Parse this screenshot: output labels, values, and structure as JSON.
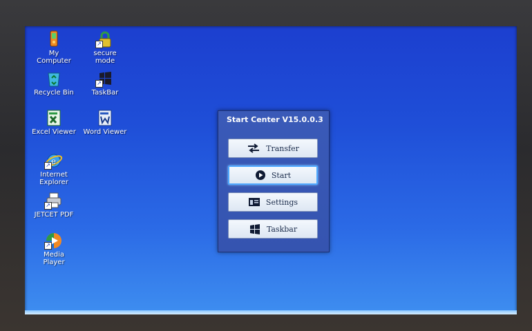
{
  "desktop": {
    "icons": [
      {
        "id": "my-computer",
        "label": "My Computer",
        "icon": "my-computer-icon"
      },
      {
        "id": "secure-mode",
        "label": "secure mode",
        "icon": "lock-icon"
      },
      {
        "id": "recycle-bin",
        "label": "Recycle Bin",
        "icon": "recycle-bin-icon"
      },
      {
        "id": "taskbar",
        "label": "TaskBar",
        "icon": "windows-logo-icon"
      },
      {
        "id": "excel-viewer",
        "label": "Excel Viewer",
        "icon": "excel-icon"
      },
      {
        "id": "word-viewer",
        "label": "Word Viewer",
        "icon": "word-icon"
      },
      {
        "id": "internet-explorer",
        "label": "Internet Explorer",
        "icon": "internet-explorer-icon"
      },
      {
        "id": "jetcet-pdf",
        "label": "JETCET PDF",
        "icon": "printer-icon"
      },
      {
        "id": "media-player",
        "label": "Media Player",
        "icon": "media-player-icon"
      }
    ]
  },
  "start_center": {
    "title": "Start Center V15.0.0.3",
    "buttons": [
      {
        "label": "Transfer",
        "icon": "transfer-arrows-icon"
      },
      {
        "label": "Start",
        "icon": "play-icon",
        "active": true
      },
      {
        "label": "Settings",
        "icon": "settings-window-icon"
      },
      {
        "label": "Taskbar",
        "icon": "windows-logo-icon"
      }
    ]
  },
  "colors": {
    "desktop_top": "#1c3fcf",
    "desktop_bottom": "#3e8ef0",
    "panel": "#3554b0",
    "button_face": "#eaf1f9",
    "active_border": "#4fa8ff"
  }
}
